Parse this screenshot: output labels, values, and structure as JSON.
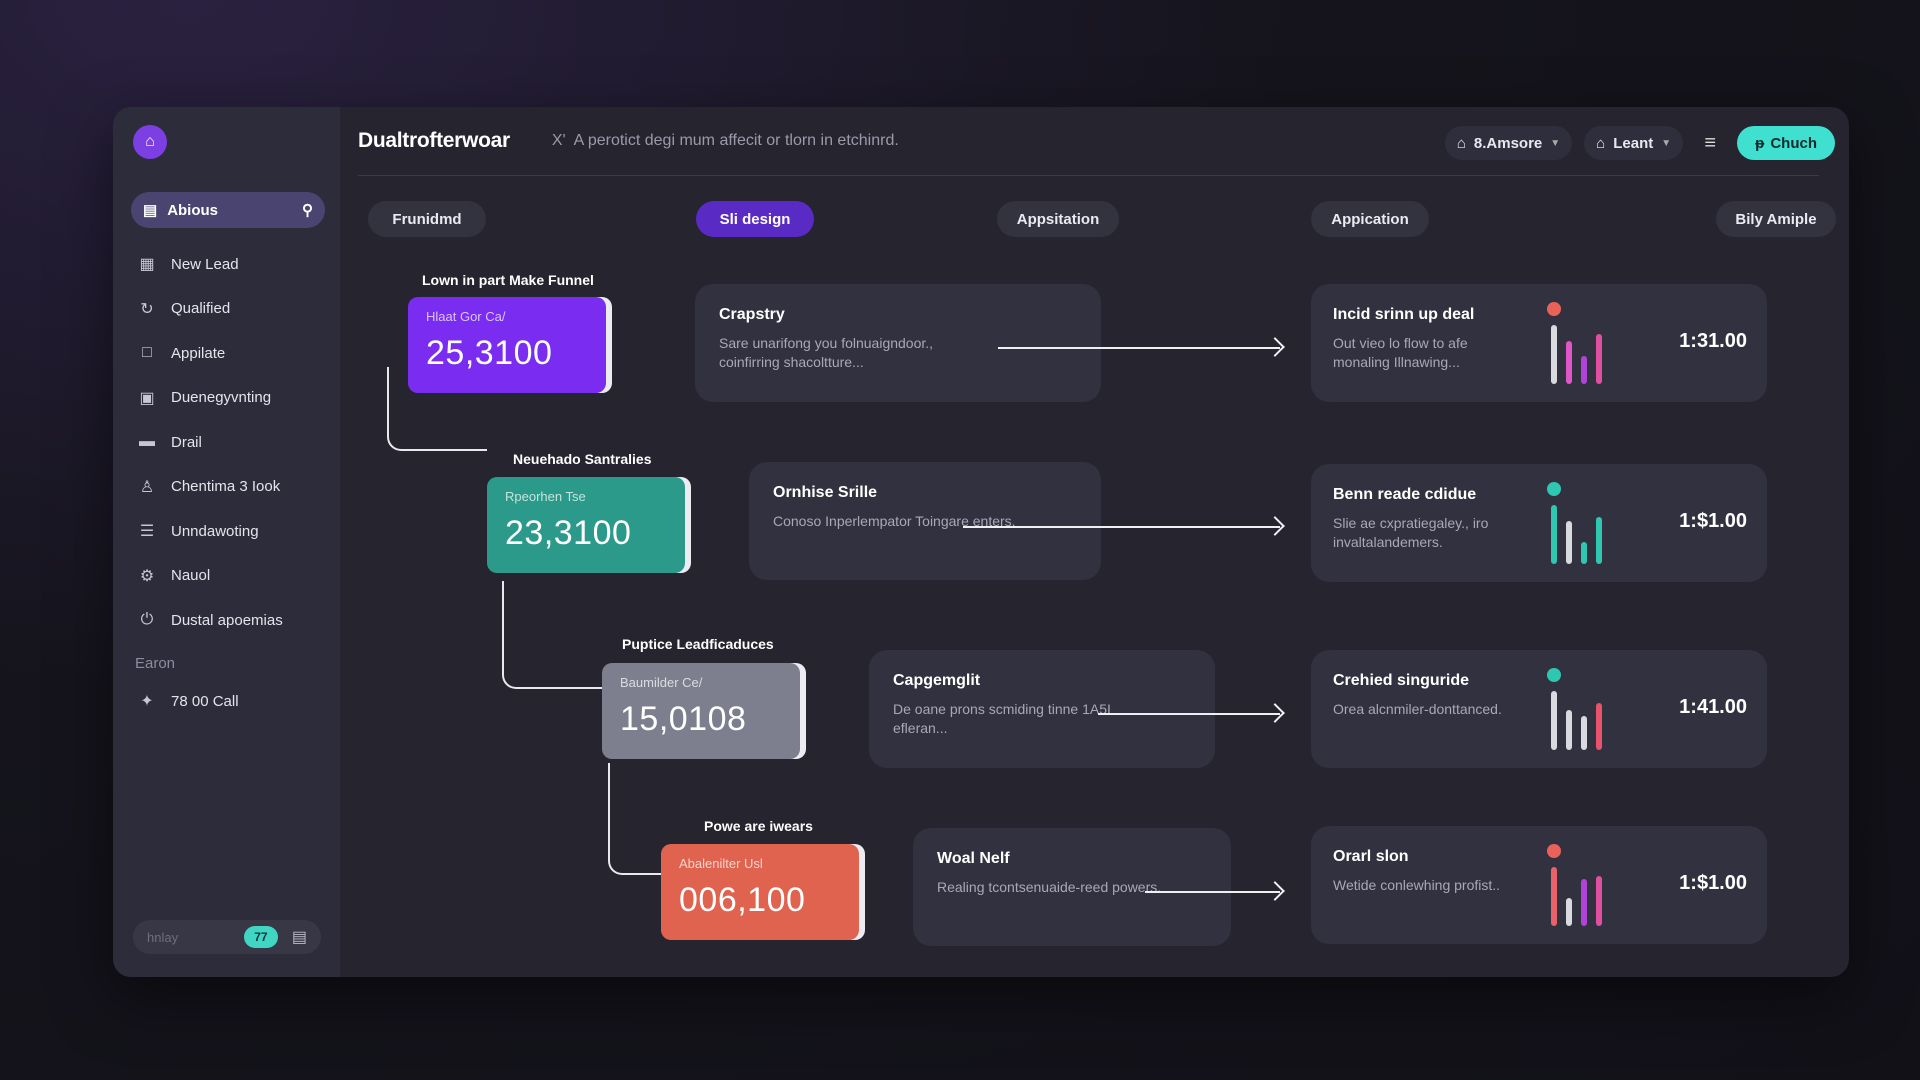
{
  "sidebar": {
    "search_label": "Abious",
    "items": [
      {
        "label": "New Lead",
        "icon": "newspaper-icon"
      },
      {
        "label": "Qualified",
        "icon": "refresh-icon"
      },
      {
        "label": "Appilate",
        "icon": "square-icon"
      },
      {
        "label": "Duenegyvnting",
        "icon": "calendar-icon"
      },
      {
        "label": "Drail",
        "icon": "folder-icon"
      },
      {
        "label": "Chentima 3 Iook",
        "icon": "user-icon"
      },
      {
        "label": "Unndawoting",
        "icon": "document-icon"
      },
      {
        "label": "Nauol",
        "icon": "gear-icon"
      },
      {
        "label": "Dustal apoemias",
        "icon": "power-icon"
      }
    ],
    "section_title": "Earon",
    "extra_items": [
      {
        "label": "78 00 Call",
        "icon": "settings-icon"
      }
    ],
    "bottom": {
      "label": "hnlay",
      "badge": "77"
    }
  },
  "header": {
    "title": "Dualtrofterwoar",
    "description_icon": "X'",
    "description": "A perotict degi mum affecit or tlorn in etchinrd.",
    "location": "8.Amsore",
    "user": "Leant",
    "cta": "Chuch"
  },
  "tabs": [
    "Frunidmd",
    "Sli design",
    "Appsitation",
    "Appication",
    "Bily Amiple"
  ],
  "stages": [
    {
      "label": "Lown in part Make Funnel",
      "sub": "Hlaat Gor Ca/",
      "value": "25,3100",
      "color": "#7a2df0"
    },
    {
      "label": "Neuehado Santralies",
      "sub": "Rpeorhen Tse",
      "value": "23,3100",
      "color": "#2b9a8a"
    },
    {
      "label": "Puptice Leadficaduces",
      "sub": "Baumilder Ce/",
      "value": "15,0108",
      "color": "#7e7f8e"
    },
    {
      "label": "Powe are iwears",
      "sub": "Abalenilter Usl",
      "value": "006,100",
      "color": "#e0634f"
    }
  ],
  "steps": [
    {
      "title": "Crapstry",
      "desc": "Sare unarifong you folnuaigndoor., coinfirring shacoltture..."
    },
    {
      "title": "Ornhise Srille",
      "desc": "Conoso Inperlempator Toingare enters."
    },
    {
      "title": "Capgemglit",
      "desc": "De oane prons scmiding tinne 1A5I efleran..."
    },
    {
      "title": "Woal Nelf",
      "desc": "Realing tcontsenuaide-reed powers."
    }
  ],
  "results": [
    {
      "title": "Incid srinn up deal",
      "desc": "Out vieo lo flow to afe monaling Illnawing...",
      "price": "1:31.00",
      "dot_color": "#e8625a",
      "bar_colors": [
        "#d9d9e0",
        "#e056c8",
        "#b044d8",
        "#e04fa0"
      ],
      "bar_values": [
        0.95,
        0.7,
        0.45,
        0.8
      ]
    },
    {
      "title": "Benn reade cdidue",
      "desc": "Slie ae cxpratiegaley., iro invaltalandemers.",
      "price": "1:$1.00",
      "dot_color": "#2fc7b0",
      "bar_colors": [
        "#2fc7b0",
        "#d9d9e0",
        "#2fc7b0",
        "#2fc7b0"
      ],
      "bar_values": [
        0.95,
        0.7,
        0.35,
        0.75
      ]
    },
    {
      "title": "Crehied singuride",
      "desc": "Orea alcnmiler-donttanced.",
      "price": "1:41.00",
      "dot_color": "#2fc7b0",
      "bar_colors": [
        "#d9d9e0",
        "#d9d9e0",
        "#d9d9e0",
        "#e8526a"
      ],
      "bar_values": [
        0.95,
        0.65,
        0.55,
        0.75
      ]
    },
    {
      "title": "Orarl slon",
      "desc": "Wetide conlewhing profist..",
      "price": "1:$1.00",
      "dot_color": "#e8625a",
      "bar_colors": [
        "#e8626a",
        "#d9d9e0",
        "#b044d8",
        "#e04fa0"
      ],
      "bar_values": [
        0.95,
        0.45,
        0.75,
        0.8
      ]
    }
  ]
}
